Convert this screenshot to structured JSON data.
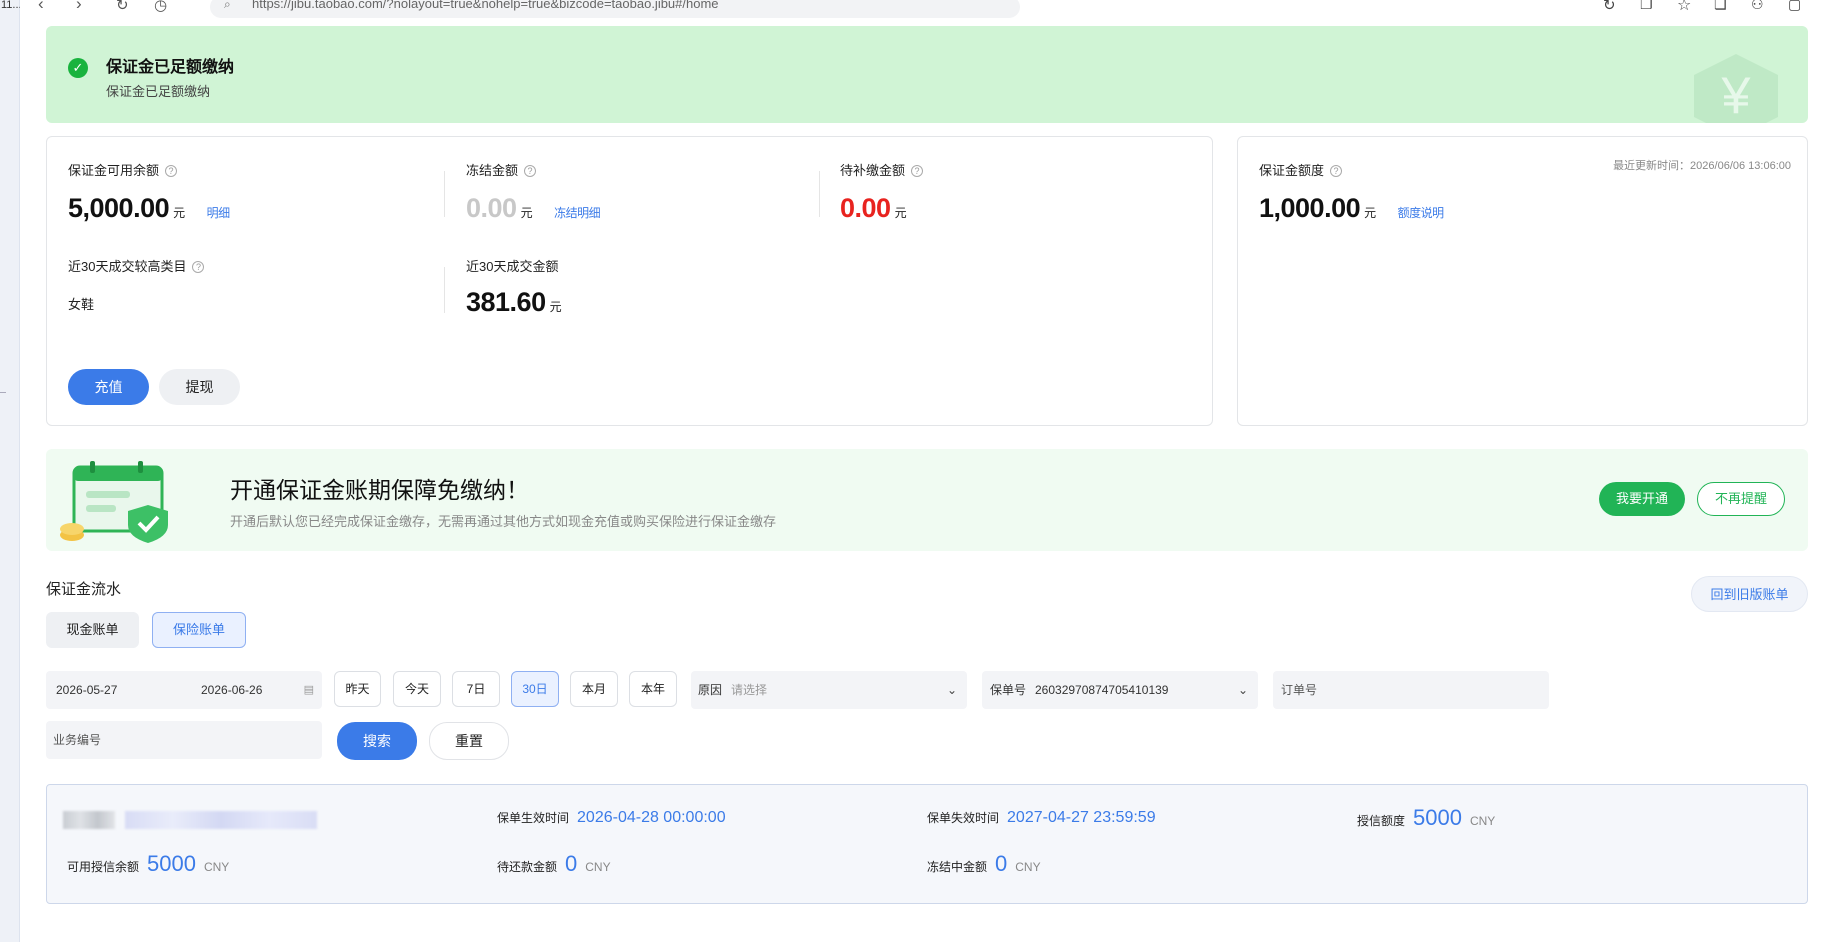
{
  "left_strip": {
    "label": "11..."
  },
  "browser": {
    "url": "https://jibu.taobao.com/?nolayout=true&nohelp=true&bizcode=taobao.jibu#/home"
  },
  "banner": {
    "title": "保证金已足额缴纳",
    "subtitle": "保证金已足额缴纳",
    "icon_glyph": "¥"
  },
  "balance_card": {
    "available_label": "保证金可用余额",
    "available_value": "5,000.00",
    "available_unit": "元",
    "available_link": "明细",
    "frozen_label": "冻结金额",
    "frozen_value": "0.00",
    "frozen_unit": "元",
    "frozen_link": "冻结明细",
    "pending_label": "待补缴金额",
    "pending_value": "0.00",
    "pending_unit": "元",
    "top_category_label": "近30天成交较高类目",
    "top_category_value": "女鞋",
    "turnover_label": "近30天成交金额",
    "turnover_value": "381.60",
    "turnover_unit": "元",
    "recharge_button": "充值",
    "withdraw_button": "提现"
  },
  "quota_card": {
    "label": "保证金额度",
    "updated": "最近更新时间：2026/06/06 13:06:00",
    "value": "1,000.00",
    "unit": "元",
    "link": "额度说明"
  },
  "promo": {
    "title": "开通保证金账期保障免缴纳！",
    "desc": "开通后默认您已经完成保证金缴存，无需再通过其他方式如现金充值或购买保险进行保证金缴存",
    "primary_button": "我要开通",
    "secondary_button": "不再提醒"
  },
  "flow": {
    "title": "保证金流水",
    "old_bill_button": "回到旧版账单",
    "tabs": [
      "现金账单",
      "保险账单"
    ]
  },
  "filters": {
    "date_start": "2026-05-27",
    "date_end": "2026-06-26",
    "quick": [
      "昨天",
      "今天",
      "7日",
      "30日",
      "本月",
      "本年"
    ],
    "reason_label": "原因",
    "reason_placeholder": "请选择",
    "policy_label": "保单号",
    "policy_value": "26032970874705410139",
    "order_placeholder": "订单号",
    "business_placeholder": "业务编号",
    "search_button": "搜索",
    "reset_button": "重置"
  },
  "result": {
    "effective_label": "保单生效时间",
    "effective_value": "2026-04-28 00:00:00",
    "expire_label": "保单失效时间",
    "expire_value": "2027-04-27 23:59:59",
    "credit_label": "授信额度",
    "credit_value": "5000",
    "available_credit_label": "可用授信余额",
    "available_credit_value": "5000",
    "repay_label": "待还款金额",
    "repay_value": "0",
    "frozen_label": "冻结中金额",
    "frozen_value": "0",
    "currency": "CNY"
  },
  "colors": {
    "accent": "#3b7be8",
    "success": "#19b33e",
    "danger": "#e8231f",
    "banner_bg": "#d0f4d5"
  }
}
